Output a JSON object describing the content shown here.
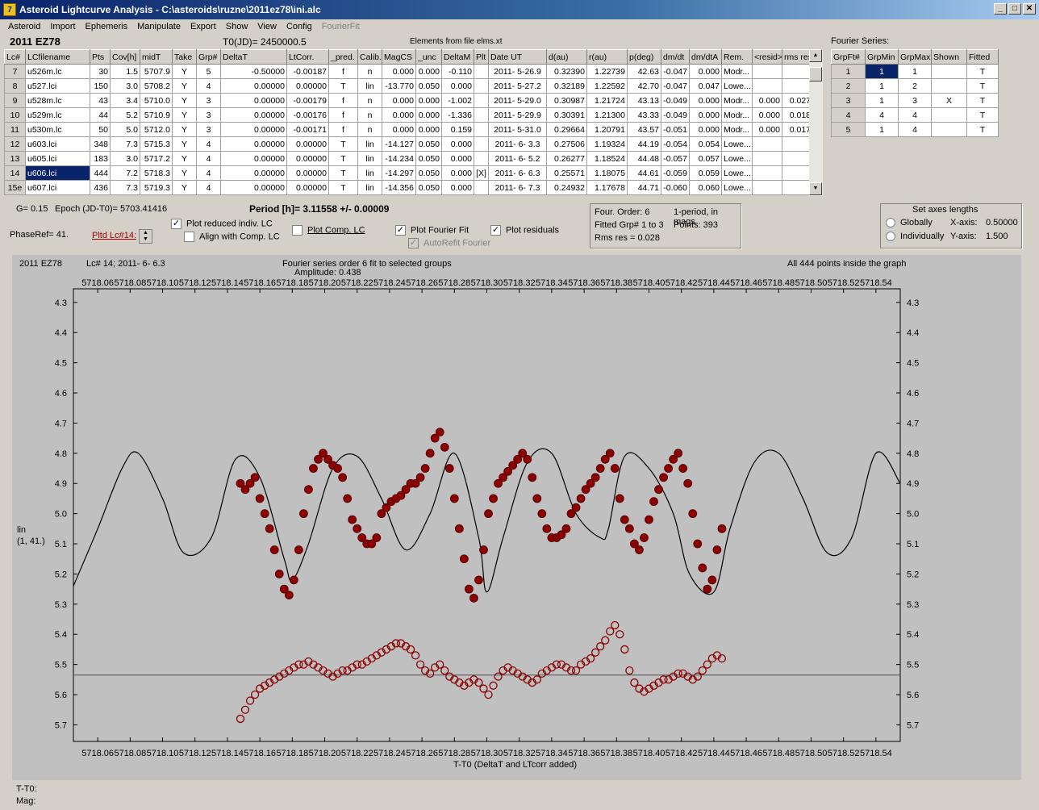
{
  "window": {
    "title": "Asteroid Lightcurve Analysis - C:\\asteroids\\ruzne\\2011ez78\\ini.alc",
    "icon": "app-icon",
    "min_label": "_",
    "max_label": "□",
    "close_label": "✕"
  },
  "menu": [
    "Asteroid",
    "Import",
    "Ephemeris",
    "Manipulate",
    "Export",
    "Show",
    "View",
    "Config",
    "FourierFit"
  ],
  "header": {
    "asteroid": "2011 EZ78",
    "t0": "T0(JD)= 2450000.5",
    "elements": "Elements from file elms.xt",
    "fourier_title": "Fourier Series:"
  },
  "lc_table": {
    "columns": [
      "Lc#",
      "LCfilename",
      "Pts",
      "Cov[h]",
      "midT",
      "Take",
      "Grp#",
      "DeltaT",
      "LtCorr.",
      "_pred.",
      "Calib.",
      "MagCS",
      "_unc",
      "DeltaM",
      "Plt",
      "Date UT",
      "d(au)",
      "r(au)",
      "p(deg)",
      "dm/dt",
      "dm/dtA",
      "Rem.",
      "<resid>",
      "rms res"
    ],
    "rows": [
      [
        "7",
        "u526m.lc",
        "30",
        "1.5",
        "5707.9",
        "Y",
        "5",
        "-0.50000",
        "-0.00187",
        "f",
        "n",
        "0.000",
        "0.000",
        "-0.110",
        "",
        "2011- 5-26.9",
        "0.32390",
        "1.22739",
        "42.63",
        "-0.047",
        "0.000",
        "Modr...",
        "",
        ""
      ],
      [
        "8",
        "u527.lci",
        "150",
        "3.0",
        "5708.2",
        "Y",
        "4",
        "0.00000",
        "0.00000",
        "T",
        "lin",
        "-13.770",
        "0.050",
        "0.000",
        "",
        "2011- 5-27.2",
        "0.32189",
        "1.22592",
        "42.70",
        "-0.047",
        "0.047",
        "Lowe...",
        "",
        ""
      ],
      [
        "9",
        "u528m.lc",
        "43",
        "3.4",
        "5710.0",
        "Y",
        "3",
        "0.00000",
        "-0.00179",
        "f",
        "n",
        "0.000",
        "0.000",
        "-1.002",
        "",
        "2011- 5-29.0",
        "0.30987",
        "1.21724",
        "43.13",
        "-0.049",
        "0.000",
        "Modr...",
        "0.000",
        "0.027"
      ],
      [
        "10",
        "u529m.lc",
        "44",
        "5.2",
        "5710.9",
        "Y",
        "3",
        "0.00000",
        "-0.00176",
        "f",
        "n",
        "0.000",
        "0.000",
        "-1.336",
        "",
        "2011- 5-29.9",
        "0.30391",
        "1.21300",
        "43.33",
        "-0.049",
        "0.000",
        "Modr...",
        "0.000",
        "0.018"
      ],
      [
        "11",
        "u530m.lc",
        "50",
        "5.0",
        "5712.0",
        "Y",
        "3",
        "0.00000",
        "-0.00171",
        "f",
        "n",
        "0.000",
        "0.000",
        "0.159",
        "",
        "2011- 5-31.0",
        "0.29664",
        "1.20791",
        "43.57",
        "-0.051",
        "0.000",
        "Modr...",
        "0.000",
        "0.017"
      ],
      [
        "12",
        "u603.lci",
        "348",
        "7.3",
        "5715.3",
        "Y",
        "4",
        "0.00000",
        "0.00000",
        "T",
        "lin",
        "-14.127",
        "0.050",
        "0.000",
        "",
        "2011- 6- 3.3",
        "0.27506",
        "1.19324",
        "44.19",
        "-0.054",
        "0.054",
        "Lowe...",
        "",
        ""
      ],
      [
        "13",
        "u605.lci",
        "183",
        "3.0",
        "5717.2",
        "Y",
        "4",
        "0.00000",
        "0.00000",
        "T",
        "lin",
        "-14.234",
        "0.050",
        "0.000",
        "",
        "2011- 6- 5.2",
        "0.26277",
        "1.18524",
        "44.48",
        "-0.057",
        "0.057",
        "Lowe...",
        "",
        ""
      ],
      [
        "14",
        "u606.lci",
        "444",
        "7.2",
        "5718.3",
        "Y",
        "4",
        "0.00000",
        "0.00000",
        "T",
        "lin",
        "-14.297",
        "0.050",
        "0.000",
        "[X]",
        "2011- 6- 6.3",
        "0.25571",
        "1.18075",
        "44.61",
        "-0.059",
        "0.059",
        "Lowe...",
        "",
        ""
      ],
      [
        "15e",
        "u607.lci",
        "436",
        "7.3",
        "5719.3",
        "Y",
        "4",
        "0.00000",
        "0.00000",
        "T",
        "lin",
        "-14.356",
        "0.050",
        "0.000",
        "",
        "2011- 6- 7.3",
        "0.24932",
        "1.17678",
        "44.71",
        "-0.060",
        "0.060",
        "Lowe...",
        "",
        ""
      ]
    ]
  },
  "fourier_table": {
    "columns": [
      "GrpFt#",
      "GrpMin",
      "GrpMax",
      "Shown",
      "Fitted"
    ],
    "rows": [
      [
        "1",
        "1",
        "1",
        "",
        "T"
      ],
      [
        "2",
        "1",
        "2",
        "",
        "T"
      ],
      [
        "3",
        "1",
        "3",
        "X",
        "T"
      ],
      [
        "4",
        "4",
        "4",
        "",
        "T"
      ],
      [
        "5",
        "1",
        "4",
        "",
        "T"
      ]
    ]
  },
  "controls": {
    "g": "G= 0.15",
    "epoch": "Epoch (JD-T0)= 5703.41416",
    "period": "Period [h]= 3.11558 +/- 0.00009",
    "phaseref": "PhaseRef= 41.",
    "pltd_lc": "Pltd Lc#14:",
    "plot_reduced": "Plot reduced indiv. LC",
    "align_comp": "Align with Comp. LC",
    "plot_comp": "Plot Comp. LC",
    "plot_fourier": "Plot Fourier Fit",
    "autorefit": "AutoRefit Fourier",
    "plot_residuals": "Plot residuals",
    "four_order": "Four. Order:  6",
    "one_period": "1-period, in mags",
    "fitted_grp": "Fitted Grp# 1 to 3",
    "points": "Points: 393",
    "rms": "Rms res     = 0.028",
    "axes_title": "Set axes lengths",
    "globally": "Globally",
    "individually": "Individually",
    "xaxis_label": "X-axis:",
    "xaxis_value": "0.50000",
    "yaxis_label": "Y-axis:",
    "yaxis_value": "1.500"
  },
  "plot": {
    "name": "2011 EZ78",
    "lc_info": "Lc# 14; 2011- 6- 6.3",
    "fit_info": "Fourier series order 6 fit to selected groups",
    "amplitude": "Amplitude: 0.438",
    "points_info": "All 444 points inside the graph",
    "xlabel": "T-T0 (DeltaT and LTcorr added)",
    "ylabel": "lin",
    "ylabel2": "(1, 41.)",
    "status_t": "T-T0:",
    "status_mag": "Mag:"
  },
  "chart_data": {
    "type": "scatter",
    "x_range": [
      5718.045,
      5718.555
    ],
    "y_range": [
      5.755,
      4.255
    ],
    "x_ticks": [
      "5718.06",
      "5718.08",
      "5718.10",
      "5718.12",
      "5718.14",
      "5718.16",
      "5718.18",
      "5718.20",
      "5718.22",
      "5718.24",
      "5718.26",
      "5718.28",
      "5718.30",
      "5718.32",
      "5718.34",
      "5718.36",
      "5718.38",
      "5718.40",
      "5718.42",
      "5718.44",
      "5718.46",
      "5718.48",
      "5718.50",
      "5718.52",
      "5718.54"
    ],
    "y_ticks": [
      "4.3",
      "4.4",
      "4.5",
      "4.6",
      "4.7",
      "4.8",
      "4.9",
      "5.0",
      "5.1",
      "5.2",
      "5.3",
      "5.4",
      "5.5",
      "5.6",
      "5.7"
    ],
    "fit_curve": {
      "x": [
        5718.045,
        5718.06,
        5718.075,
        5718.085,
        5718.1,
        5718.113,
        5718.13,
        5718.145,
        5718.16,
        5718.175,
        5718.18,
        5718.19,
        5718.205,
        5718.22,
        5718.235,
        5718.25,
        5718.265,
        5718.28,
        5718.295,
        5718.3,
        5718.31,
        5718.325,
        5718.34,
        5718.355,
        5718.37,
        5718.375,
        5718.385,
        5718.4,
        5718.415,
        5718.425,
        5718.44,
        5718.45,
        5718.465,
        5718.48,
        5718.495,
        5718.51,
        5718.525,
        5718.54,
        5718.555
      ],
      "y": [
        5.24,
        5.05,
        4.85,
        4.8,
        4.95,
        5.13,
        5.08,
        4.82,
        4.88,
        5.15,
        5.22,
        5.1,
        4.85,
        4.81,
        4.95,
        5.12,
        5.0,
        4.8,
        5.08,
        5.26,
        5.08,
        4.83,
        4.8,
        5.0,
        5.08,
        5.05,
        4.81,
        4.85,
        5.0,
        5.2,
        5.26,
        5.05,
        4.83,
        4.8,
        4.95,
        5.13,
        5.08,
        4.8,
        4.9
      ]
    },
    "lightcurve": {
      "x": [
        5718.148,
        5718.151,
        5718.154,
        5718.157,
        5718.16,
        5718.163,
        5718.166,
        5718.169,
        5718.172,
        5718.175,
        5718.178,
        5718.181,
        5718.184,
        5718.187,
        5718.19,
        5718.193,
        5718.196,
        5718.199,
        5718.202,
        5718.205,
        5718.208,
        5718.211,
        5718.214,
        5718.217,
        5718.22,
        5718.223,
        5718.226,
        5718.229,
        5718.232,
        5718.235,
        5718.238,
        5718.241,
        5718.244,
        5718.247,
        5718.25,
        5718.253,
        5718.256,
        5718.259,
        5718.262,
        5718.265,
        5718.268,
        5718.271,
        5718.274,
        5718.277,
        5718.28,
        5718.283,
        5718.286,
        5718.289,
        5718.292,
        5718.295,
        5718.298,
        5718.301,
        5718.304,
        5718.307,
        5718.31,
        5718.313,
        5718.316,
        5718.319,
        5718.322,
        5718.325,
        5718.328,
        5718.331,
        5718.334,
        5718.337,
        5718.34,
        5718.343,
        5718.346,
        5718.349,
        5718.352,
        5718.355,
        5718.358,
        5718.361,
        5718.364,
        5718.367,
        5718.37,
        5718.373,
        5718.376,
        5718.379,
        5718.382,
        5718.385,
        5718.388,
        5718.391,
        5718.394,
        5718.397,
        5718.4,
        5718.403,
        5718.406,
        5718.409,
        5718.412,
        5718.415,
        5718.418,
        5718.421,
        5718.424,
        5718.427,
        5718.43,
        5718.433,
        5718.436,
        5718.439,
        5718.442,
        5718.445
      ],
      "y": [
        4.9,
        4.92,
        4.9,
        4.88,
        4.95,
        5.0,
        5.05,
        5.12,
        5.2,
        5.25,
        5.27,
        5.22,
        5.12,
        5.0,
        4.92,
        4.85,
        4.82,
        4.8,
        4.82,
        4.84,
        4.85,
        4.88,
        4.95,
        5.02,
        5.05,
        5.08,
        5.1,
        5.1,
        5.08,
        5.0,
        4.98,
        4.96,
        4.95,
        4.94,
        4.92,
        4.9,
        4.9,
        4.88,
        4.85,
        4.8,
        4.75,
        4.73,
        4.78,
        4.85,
        4.95,
        5.05,
        5.15,
        5.25,
        5.28,
        5.22,
        5.12,
        5.0,
        4.95,
        4.9,
        4.88,
        4.86,
        4.84,
        4.82,
        4.8,
        4.82,
        4.88,
        4.95,
        5.0,
        5.05,
        5.08,
        5.08,
        5.07,
        5.05,
        5.0,
        4.98,
        4.95,
        4.92,
        4.9,
        4.88,
        4.85,
        4.82,
        4.8,
        4.85,
        4.95,
        5.02,
        5.05,
        5.1,
        5.12,
        5.08,
        5.02,
        4.96,
        4.92,
        4.88,
        4.85,
        4.82,
        4.8,
        4.85,
        4.9,
        5.0,
        5.1,
        5.18,
        5.25,
        5.22,
        5.12,
        5.05
      ]
    },
    "residuals": {
      "zero_line": 5.535,
      "x": [
        5718.148,
        5718.151,
        5718.154,
        5718.157,
        5718.16,
        5718.163,
        5718.166,
        5718.169,
        5718.172,
        5718.175,
        5718.178,
        5718.181,
        5718.184,
        5718.187,
        5718.19,
        5718.193,
        5718.196,
        5718.199,
        5718.202,
        5718.205,
        5718.208,
        5718.211,
        5718.214,
        5718.217,
        5718.22,
        5718.223,
        5718.226,
        5718.229,
        5718.232,
        5718.235,
        5718.238,
        5718.241,
        5718.244,
        5718.247,
        5718.25,
        5718.253,
        5718.256,
        5718.259,
        5718.262,
        5718.265,
        5718.268,
        5718.271,
        5718.274,
        5718.277,
        5718.28,
        5718.283,
        5718.286,
        5718.289,
        5718.292,
        5718.295,
        5718.298,
        5718.301,
        5718.304,
        5718.307,
        5718.31,
        5718.313,
        5718.316,
        5718.319,
        5718.322,
        5718.325,
        5718.328,
        5718.331,
        5718.334,
        5718.337,
        5718.34,
        5718.343,
        5718.346,
        5718.349,
        5718.352,
        5718.355,
        5718.358,
        5718.361,
        5718.364,
        5718.367,
        5718.37,
        5718.373,
        5718.376,
        5718.379,
        5718.382,
        5718.385,
        5718.388,
        5718.391,
        5718.394,
        5718.397,
        5718.4,
        5718.403,
        5718.406,
        5718.409,
        5718.412,
        5718.415,
        5718.418,
        5718.421,
        5718.424,
        5718.427,
        5718.43,
        5718.433,
        5718.436,
        5718.439,
        5718.442,
        5718.445
      ],
      "y": [
        5.68,
        5.65,
        5.62,
        5.6,
        5.58,
        5.57,
        5.56,
        5.55,
        5.54,
        5.53,
        5.52,
        5.51,
        5.5,
        5.5,
        5.49,
        5.5,
        5.51,
        5.52,
        5.53,
        5.54,
        5.53,
        5.52,
        5.52,
        5.51,
        5.5,
        5.5,
        5.49,
        5.48,
        5.47,
        5.46,
        5.45,
        5.44,
        5.43,
        5.43,
        5.44,
        5.45,
        5.47,
        5.5,
        5.52,
        5.53,
        5.51,
        5.5,
        5.52,
        5.54,
        5.55,
        5.56,
        5.57,
        5.56,
        5.55,
        5.56,
        5.58,
        5.6,
        5.57,
        5.54,
        5.52,
        5.51,
        5.52,
        5.53,
        5.54,
        5.55,
        5.56,
        5.55,
        5.53,
        5.52,
        5.51,
        5.5,
        5.5,
        5.51,
        5.52,
        5.52,
        5.5,
        5.49,
        5.48,
        5.46,
        5.44,
        5.42,
        5.39,
        5.37,
        5.4,
        5.45,
        5.52,
        5.56,
        5.58,
        5.59,
        5.58,
        5.57,
        5.56,
        5.55,
        5.55,
        5.54,
        5.53,
        5.53,
        5.54,
        5.55,
        5.54,
        5.52,
        5.5,
        5.48,
        5.47,
        5.48
      ]
    },
    "colors": {
      "points": "#8b0000",
      "fit": "#000000",
      "background": "#c0c0c0"
    }
  }
}
